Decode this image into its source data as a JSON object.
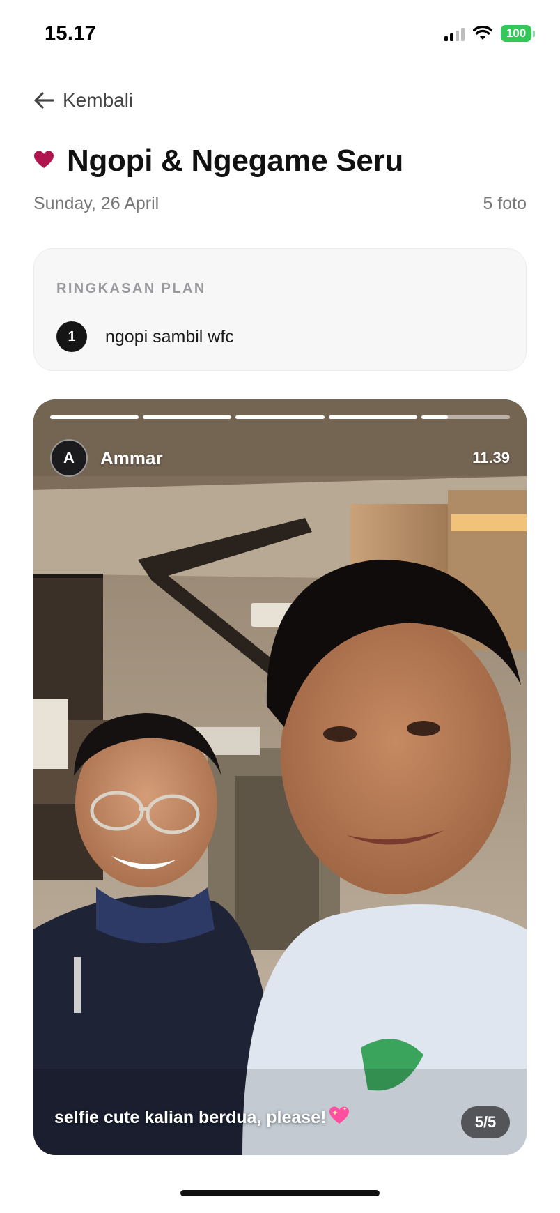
{
  "status_bar": {
    "time": "15.17",
    "battery": "100",
    "battery_color": "#34c759"
  },
  "nav": {
    "back_label": "Kembali",
    "back_icon": "arrow-left-icon"
  },
  "header": {
    "icon": "heart-icon",
    "icon_color": "#b0154f",
    "title": "Ngopi & Ngegame Seru",
    "date": "Sunday, 26 April",
    "photo_count": "5 foto"
  },
  "summary": {
    "heading": "RINGKASAN PLAN",
    "items": [
      {
        "number": "1",
        "text": "ngopi sambil wfc"
      }
    ]
  },
  "story": {
    "segments": [
      1,
      1,
      1,
      1,
      0.3
    ],
    "avatar_initial": "A",
    "author": "Ammar",
    "time": "11.39",
    "caption": "selfie cute kalian berdua, please!",
    "caption_emoji": "sparkling-heart-icon",
    "counter": "5/5"
  }
}
